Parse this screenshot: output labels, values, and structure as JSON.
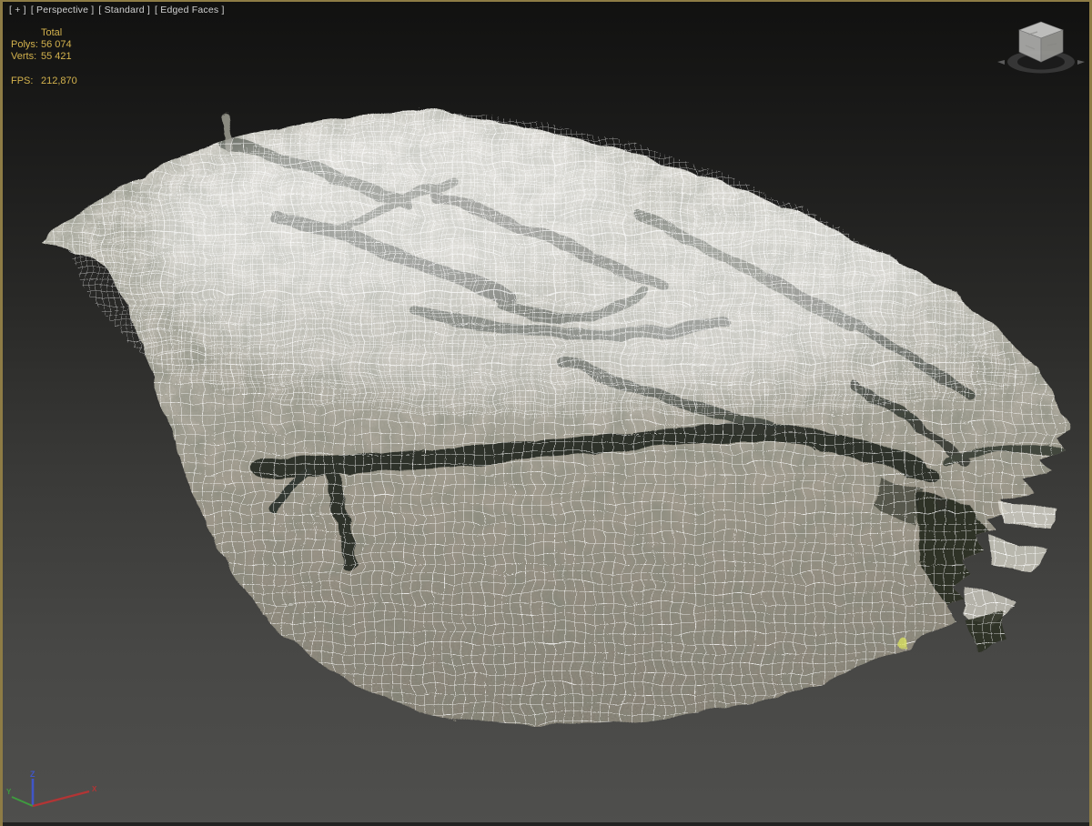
{
  "viewport": {
    "label_menus": {
      "general": "[ + ]",
      "point_of_view": "[ Perspective ]",
      "shading_standard": "[ Standard ]",
      "shading_edged_faces": "[ Edged Faces ]"
    },
    "statistics": {
      "column_header": "Total",
      "polys_label": "Polys:",
      "polys_value": "56 074",
      "verts_label": "Verts:",
      "verts_value": "55 421",
      "fps_label": "FPS:",
      "fps_value": "212,870"
    },
    "axis_gizmo": {
      "x_label": "X",
      "y_label": "Y",
      "z_label": "Z"
    },
    "icons": {
      "viewcube": "viewcube-icon",
      "axis_gizmo": "axis-tripod-icon"
    },
    "colors": {
      "active_viewport_border": "#8e7c45",
      "stats_text": "#d3b24d",
      "viewport_label_text": "#cfcfcf",
      "background_top": "#111110",
      "background_bottom": "#4f4f4d",
      "axis_x": "#b23535",
      "axis_y": "#3f9b3f",
      "axis_z": "#4056c8",
      "wireframe": "#ffffff"
    },
    "content_description": "Wireframe photogrammetry scan of forest floor with tree roots (Edged Faces display)"
  }
}
